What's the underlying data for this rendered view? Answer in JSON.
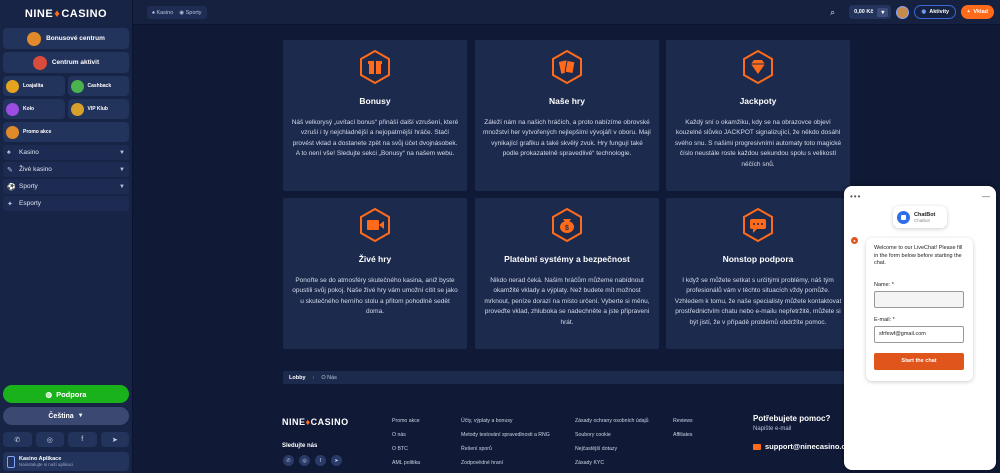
{
  "brand": {
    "logo_left": "NINE",
    "logo_right": "CASINO"
  },
  "sidebar": {
    "bonus_center": "Bonusové centrum",
    "active_center": "Centrum aktivit",
    "tiles": [
      "Loajalita",
      "Cashback",
      "Kolo",
      "VIP Klub",
      "Promo akce"
    ],
    "nav": [
      "Kasino",
      "Živé kasino",
      "Sporty",
      "Esporty"
    ],
    "support": "Podpora",
    "language": "Čeština",
    "app_title": "Kasino Aplikace",
    "app_sub": "Nainstalujte si naší aplikaci"
  },
  "topbar": {
    "tabs": [
      "Kasino",
      "Sporty"
    ],
    "balance": "0,00 Kč",
    "activity": "Aktivity",
    "deposit": "Vklad"
  },
  "cards": [
    {
      "title": "Bonusy",
      "text": "Náš velkorysý „uvítací bonus“ přináší další vzrušení, které vzruší i ty nejchladnější a nejopatrnější hráče. Stačí provést vklad a dostanete zpět na svůj účet dvojnásobek. A to není vše! Sledujte sekci „Bonusy“ na našem webu."
    },
    {
      "title": "Naše hry",
      "text": "Záleží nám na našich hráčích, a proto nabízíme obrovské množství her vytvořených nejlepšími vývojáři v oboru. Mají vynikající grafiku a také skvělý zvuk. Hry fungují také podle prokazatelně spravedlivé“ technologie."
    },
    {
      "title": "Jackpoty",
      "text": "Každý sní o okamžiku, kdy se na obrazovce objeví kouzelné slůvko JACKPOT signalizující, že někdo dosáhl svého snu. S našimi progresivními automaty toto magické číslo neustále roste každou sekundou spolu s velikostí něčích snů."
    },
    {
      "title": "Živé hry",
      "text": "Ponořte se do atmosféry skutečného kasina, aniž byste opustili svůj pokoj. Naše živé hry vám umožní cítit se jako u skutečného herního stolu a přitom pohodlně sedět doma."
    },
    {
      "title": "Platební systémy a bezpečnost",
      "text": "Nikdo nerad čeká. Našim hráčům můžeme nabídnout okamžité vklady a výplaty. Než budete mít možnost mrknout, peníze dorazí na místo určení. Vyberte si měnu, proveďte vklad, zhluboka se nadechněte a jste připraveni hrát."
    },
    {
      "title": "Nonstop podpora",
      "text": "I když se můžete setkat s určitými problémy, náš tým profesionálů vám v těchto situacích vždy pomůže. Vzhledem k tomu, že naše specialisty můžete kontaktovat prostřednictvím chatu nebo e-mailu nepřetržitě, můžete si být jistí, že v případě problémů obdržíte pomoc."
    }
  ],
  "breadcrumb": {
    "lobby": "Lobby",
    "current": "O Nás"
  },
  "footer": {
    "follow": "Sledujte nás",
    "col1": [
      "Promo akce",
      "O nás",
      "O BTC",
      "AML politika"
    ],
    "col2": [
      "Účty, výplaty a bonusy",
      "Metody testování spravedlnosti a RNG",
      "Řešení sporů",
      "Zodpovědné hraní"
    ],
    "col3": [
      "Zásady ochrany osobních údajů",
      "Soubory cookie",
      "Nejčastější dotazy",
      "Zásady KYC"
    ],
    "col4": [
      "Reviews",
      "Affiliates"
    ],
    "help_title": "Potřebujete pomoc?",
    "help_sub": "Napište e-mail",
    "email": "support@ninecasino.com"
  },
  "chat": {
    "bot_name": "ChatBot",
    "bot_role": "Chatbot",
    "welcome": "Welcome to our LiveChat! Please fill in the form below before starting the chat.",
    "name_label": "Name: *",
    "name_value": "",
    "email_label": "E-mail: *",
    "email_value": "sfrfewf@gmail.com",
    "start": "Start the chat"
  },
  "colors": {
    "accent": "#ff6b1a",
    "support_green": "#1ab21a",
    "chat_button": "#e0551b"
  }
}
